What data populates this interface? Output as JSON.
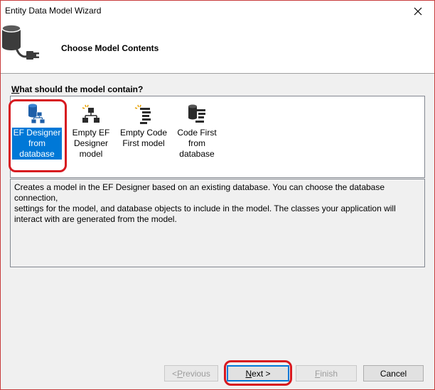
{
  "window": {
    "title": "Entity Data Model Wizard",
    "close_glyph": "✕"
  },
  "header": {
    "title": "Choose Model Contents",
    "icon": "database-plug-icon"
  },
  "question": {
    "prefix": "W",
    "rest": "hat should the model contain?"
  },
  "options": [
    {
      "label_lines": [
        "EF Designer",
        "from",
        "database"
      ],
      "icon": "ef-designer-from-database-icon",
      "selected": true
    },
    {
      "label_lines": [
        "Empty EF",
        "Designer",
        "model"
      ],
      "icon": "empty-ef-designer-model-icon",
      "selected": false
    },
    {
      "label_lines": [
        "Empty Code",
        "First model"
      ],
      "icon": "empty-code-first-model-icon",
      "selected": false
    },
    {
      "label_lines": [
        "Code First",
        "from",
        "database"
      ],
      "icon": "code-first-from-database-icon",
      "selected": false
    }
  ],
  "description": {
    "lines": [
      "Creates a model in the EF Designer based on an existing database. You can choose the database connection,",
      "settings for the model, and database objects to include in the model. The classes your application will",
      "interact with are generated from the model."
    ]
  },
  "buttons": {
    "previous_prefix": "< ",
    "previous_u": "P",
    "previous_rest": "revious",
    "next_u": "N",
    "next_rest": "ext >",
    "finish_u": "F",
    "finish_rest": "inish",
    "cancel": "Cancel"
  },
  "colors": {
    "selection": "#0078d7",
    "annotation_ring": "#d71920"
  }
}
